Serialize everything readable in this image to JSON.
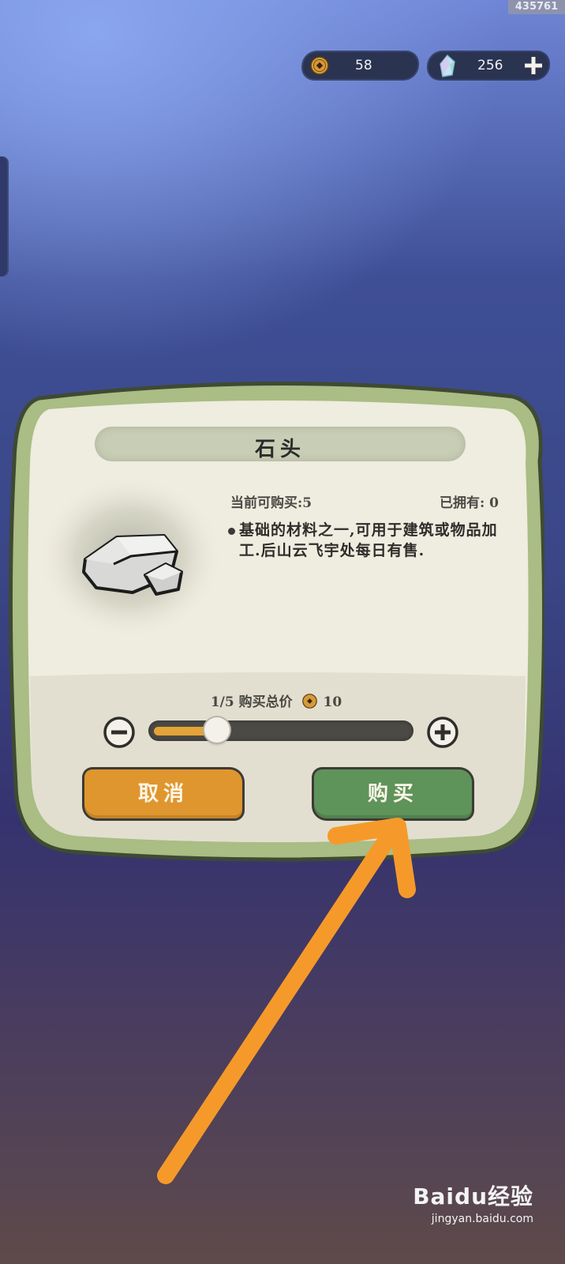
{
  "corner_id": "435761",
  "currency": {
    "coins": "58",
    "gems": "256"
  },
  "dialog": {
    "title": "石头",
    "stock_label": "当前可购买:5",
    "owned_label": "已拥有: 0",
    "description": "基础的材料之一,可用于建筑或物品加工.后山云飞宇处每日有售.",
    "quantity_text": "1/5 购买总价",
    "total_price": "10",
    "quantity_fraction": 0.2,
    "cancel_label": "取消",
    "buy_label": "购买"
  },
  "watermark": {
    "logo": "Baidu经验",
    "url": "jingyan.baidu.com"
  },
  "colors": {
    "accent_orange": "#e0962e",
    "accent_green": "#5e935a",
    "panel_border": "#a9bd84",
    "panel_fill": "#efece0",
    "arrow": "#f59a2a"
  }
}
